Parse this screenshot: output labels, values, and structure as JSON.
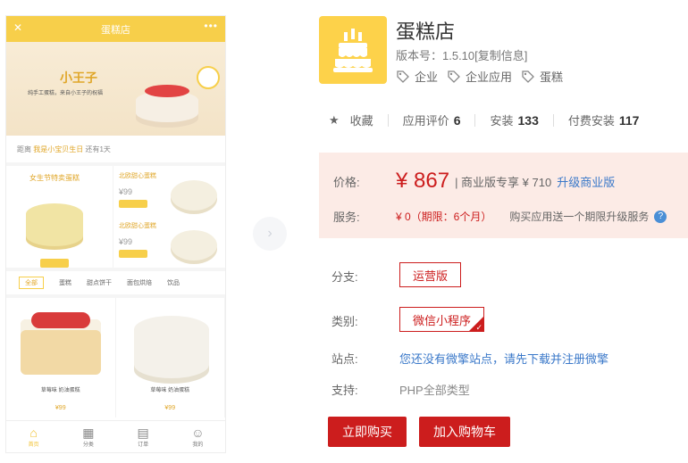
{
  "phone": {
    "title": "蛋糕店",
    "banner": {
      "logo": "小王子",
      "tagline": "纯手工蛋糕，来自小王子的祝福"
    },
    "ticker": {
      "prefix": "距离",
      "highlight": "我是小宝贝生日",
      "suffix": "还有1天"
    },
    "promo": {
      "left_title": "女生节特卖蛋糕",
      "items": [
        {
          "name": "北欧甜心蛋糕",
          "price": "¥99"
        },
        {
          "name": "北欧甜心蛋糕",
          "price": "¥99"
        }
      ]
    },
    "tabs": [
      "全部",
      "蛋糕",
      "甜点饼干",
      "面包烘焙",
      "饮品"
    ],
    "products": [
      {
        "name": "草莓味 奶油蛋糕",
        "price": "¥99"
      },
      {
        "name": "草莓味 奶油蛋糕",
        "price": "¥99"
      }
    ],
    "nav": [
      "首页",
      "分类",
      "订单",
      "我的"
    ]
  },
  "app": {
    "title": "蛋糕店",
    "version": "版本号：1.5.10[复制信息]",
    "tags": [
      "企业",
      "企业应用",
      "蛋糕"
    ]
  },
  "stats": {
    "favorite": "收藏",
    "rating_label": "应用评价",
    "rating_value": "6",
    "install_label": "安装",
    "install_value": "133",
    "paid_label": "付费安装",
    "paid_value": "117"
  },
  "pricing": {
    "price_label": "价格:",
    "price": "¥ 867",
    "business": "| 商业版专享 ¥ 710",
    "upgrade": "升级商业版",
    "service_label": "服务:",
    "service_value": "¥ 0（期限：6个月）",
    "service_note": "购买应用送一个期限升级服务",
    "help": "?"
  },
  "details": {
    "branch_label": "分支:",
    "branch_value": "运营版",
    "category_label": "类别:",
    "category_value": "微信小程序",
    "site_label": "站点:",
    "site_value": "您还没有微擎站点，请先下载并注册微擎",
    "support_label": "支持:",
    "support_value": "PHP全部类型"
  },
  "actions": {
    "buy": "立即购买",
    "cart": "加入购物车"
  },
  "colors": {
    "accent": "#cc1d1d",
    "link": "#3a78c9",
    "icon_bg": "#fdd24a",
    "price_bg": "#fcebe6"
  }
}
